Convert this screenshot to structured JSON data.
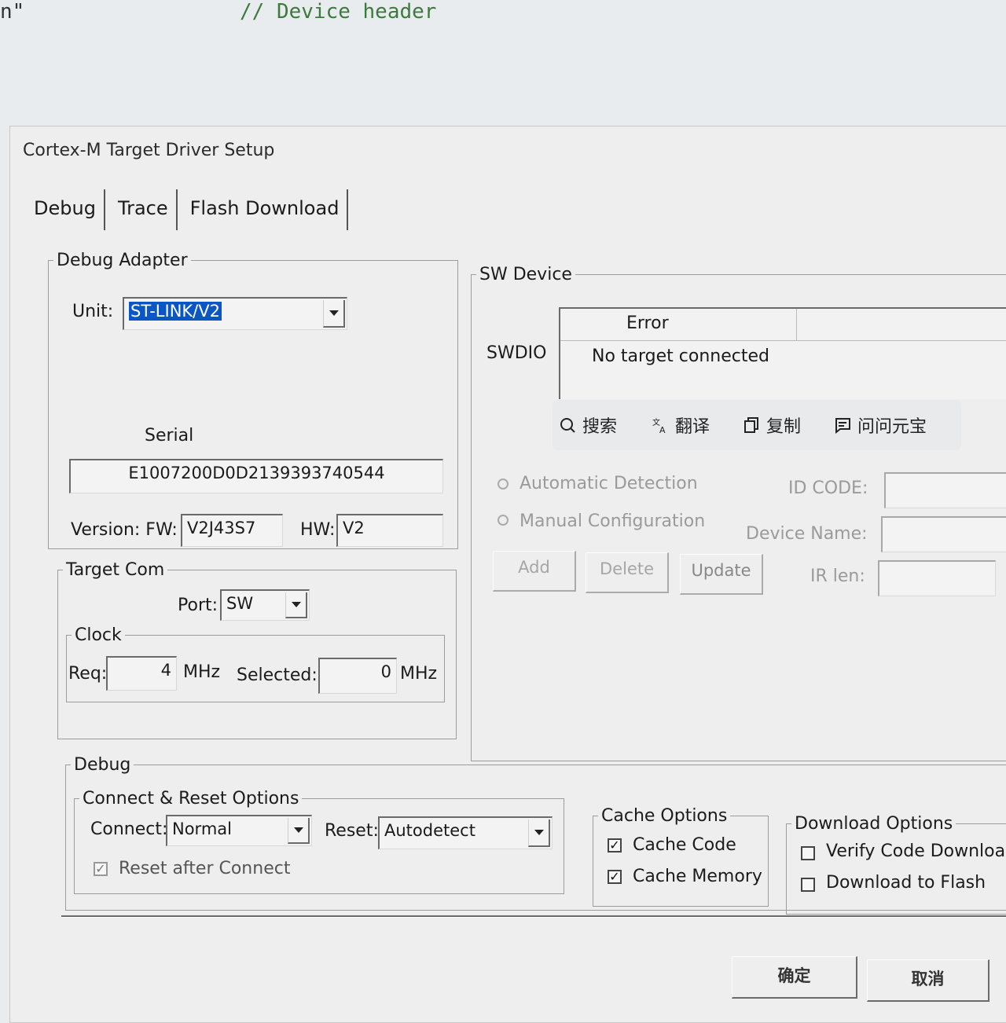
{
  "editor": {
    "fragment": "n\"",
    "comment": "// Device header"
  },
  "dialog": {
    "title": "Cortex-M Target Driver Setup",
    "tabs": [
      "Debug",
      "Trace",
      "Flash Download"
    ]
  },
  "debug_adapter": {
    "legend": "Debug Adapter",
    "unit_label": "Unit:",
    "unit_value": "ST-LINK/V2",
    "serial_label": "Serial",
    "serial_value": "E1007200D0D2139393740544",
    "version_label": "Version: FW:",
    "fw_value": "V2J43S7",
    "hw_label": "HW:",
    "hw_value": "V2"
  },
  "target_com": {
    "legend": "Target Com",
    "port_label": "Port:",
    "port_value": "SW",
    "clock_legend": "Clock",
    "req_label": "Req:",
    "req_value": "4",
    "mhz1": "MHz",
    "selected_label": "Selected:",
    "selected_value": "0",
    "mhz2": "MHz"
  },
  "sw_device": {
    "legend": "SW Device",
    "swdio_label": "SWDIO",
    "error_header": "Error",
    "error_message": "No target connected",
    "auto_detection": "Automatic Detection",
    "manual_config": "Manual Configuration",
    "id_code_label": "ID CODE:",
    "device_name_label": "Device Name:",
    "ir_len_label": "IR len:",
    "buttons": {
      "add": "Add",
      "delete": "Delete",
      "update": "Update"
    }
  },
  "popup_toolbar": {
    "search": "搜索",
    "translate": "翻译",
    "copy": "复制",
    "ask": "问问元宝"
  },
  "debug": {
    "legend": "Debug",
    "connect_reset_legend": "Connect & Reset Options",
    "connect_label": "Connect:",
    "connect_value": "Normal",
    "reset_label": "Reset:",
    "reset_value": "Autodetect",
    "reset_after_connect": "Reset after Connect",
    "reset_after_connect_checked": true,
    "cache_legend": "Cache Options",
    "cache_code": "Cache Code",
    "cache_code_checked": true,
    "cache_memory": "Cache Memory",
    "cache_memory_checked": true,
    "download_legend": "Download Options",
    "verify_code": "Verify Code Downloa",
    "verify_code_checked": false,
    "download_flash": "Download to Flash",
    "download_flash_checked": false
  },
  "footer": {
    "ok": "确定",
    "cancel": "取消"
  }
}
